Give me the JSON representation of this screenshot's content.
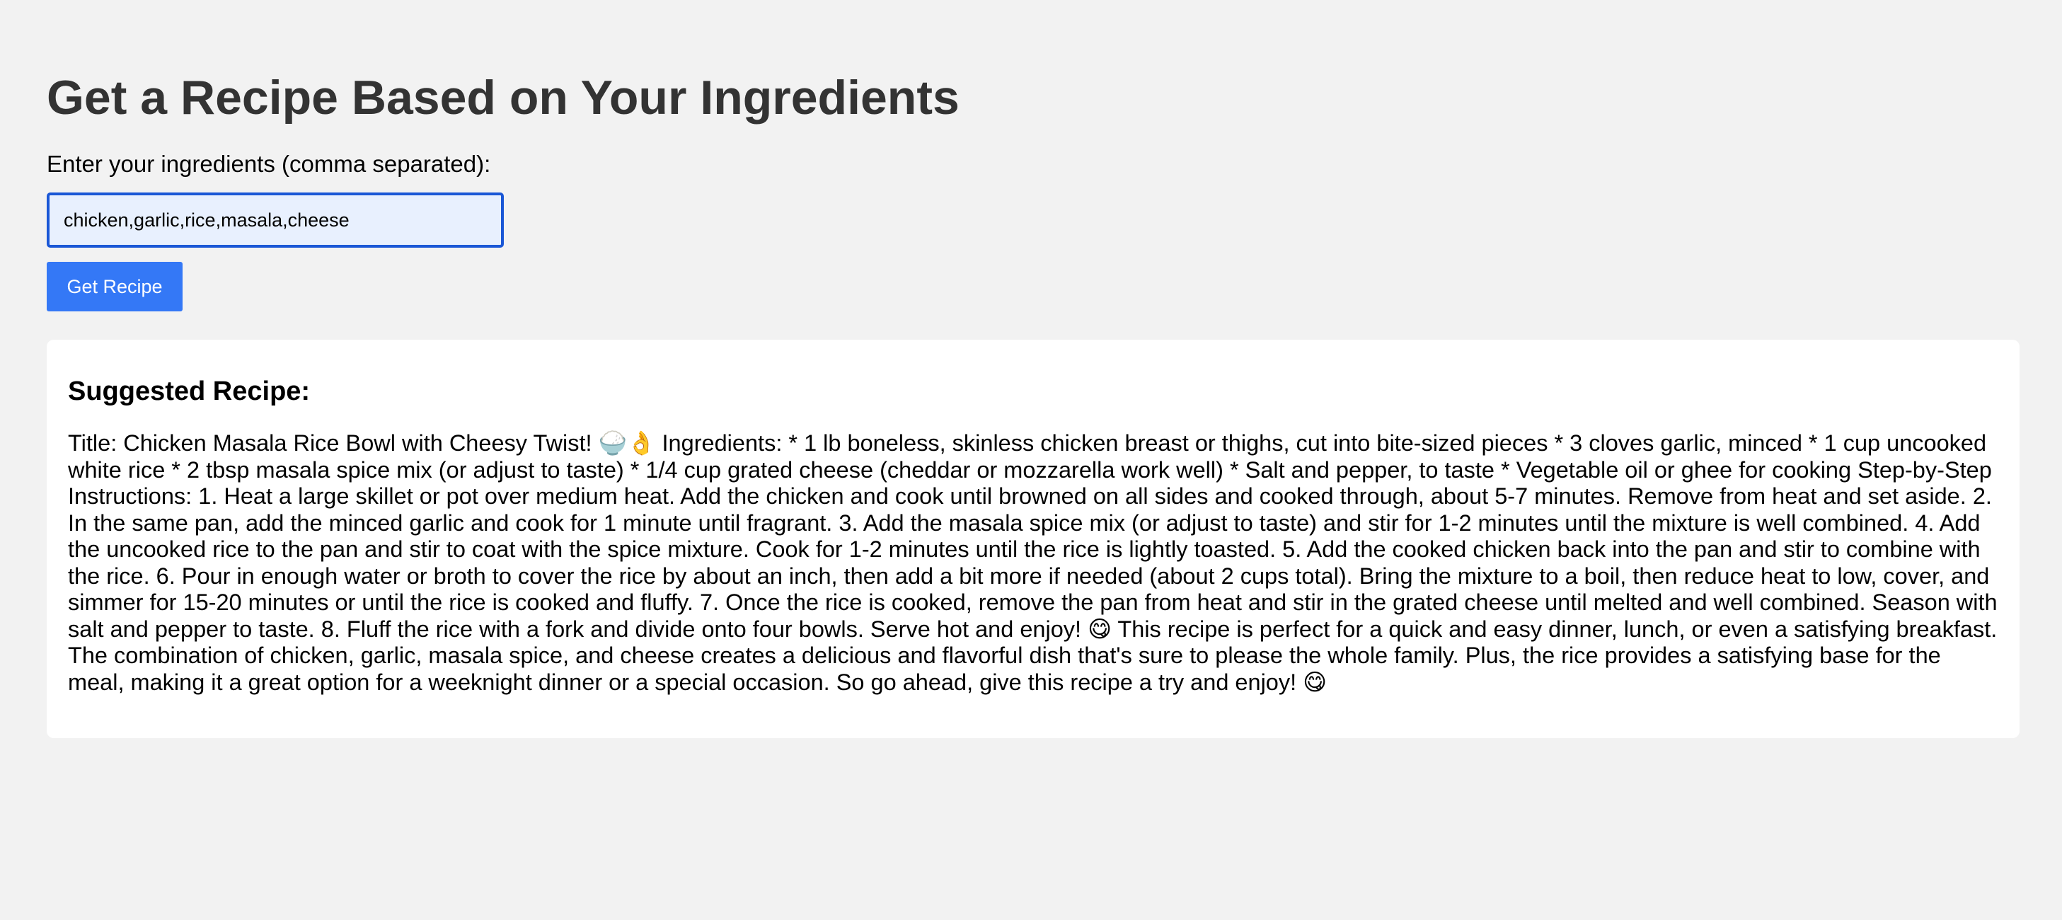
{
  "page": {
    "title": "Get a Recipe Based on Your Ingredients"
  },
  "form": {
    "label": "Enter your ingredients (comma separated):",
    "input_value": "chicken,garlic,rice,masala,cheese",
    "button_label": "Get Recipe"
  },
  "result": {
    "heading": "Suggested Recipe:",
    "text": "Title: Chicken Masala Rice Bowl with Cheesy Twist! 🍚👌 Ingredients: * 1 lb boneless, skinless chicken breast or thighs, cut into bite-sized pieces * 3 cloves garlic, minced * 1 cup uncooked white rice * 2 tbsp masala spice mix (or adjust to taste) * 1/4 cup grated cheese (cheddar or mozzarella work well) * Salt and pepper, to taste * Vegetable oil or ghee for cooking Step-by-Step Instructions: 1. Heat a large skillet or pot over medium heat. Add the chicken and cook until browned on all sides and cooked through, about 5-7 minutes. Remove from heat and set aside. 2. In the same pan, add the minced garlic and cook for 1 minute until fragrant. 3. Add the masala spice mix (or adjust to taste) and stir for 1-2 minutes until the mixture is well combined. 4. Add the uncooked rice to the pan and stir to coat with the spice mixture. Cook for 1-2 minutes until the rice is lightly toasted. 5. Add the cooked chicken back into the pan and stir to combine with the rice. 6. Pour in enough water or broth to cover the rice by about an inch, then add a bit more if needed (about 2 cups total). Bring the mixture to a boil, then reduce heat to low, cover, and simmer for 15-20 minutes or until the rice is cooked and fluffy. 7. Once the rice is cooked, remove the pan from heat and stir in the grated cheese until melted and well combined. Season with salt and pepper to taste. 8. Fluff the rice with a fork and divide onto four bowls. Serve hot and enjoy! 😋 This recipe is perfect for a quick and easy dinner, lunch, or even a satisfying breakfast. The combination of chicken, garlic, masala spice, and cheese creates a delicious and flavorful dish that's sure to please the whole family. Plus, the rice provides a satisfying base for the meal, making it a great option for a weeknight dinner or a special occasion. So go ahead, give this recipe a try and enjoy! 😋"
  },
  "colors": {
    "background": "#f2f2f2",
    "title": "#333333",
    "button": "#3478f6",
    "input_border": "#1a57d6",
    "input_background": "#e8f0fe",
    "card": "#ffffff"
  }
}
